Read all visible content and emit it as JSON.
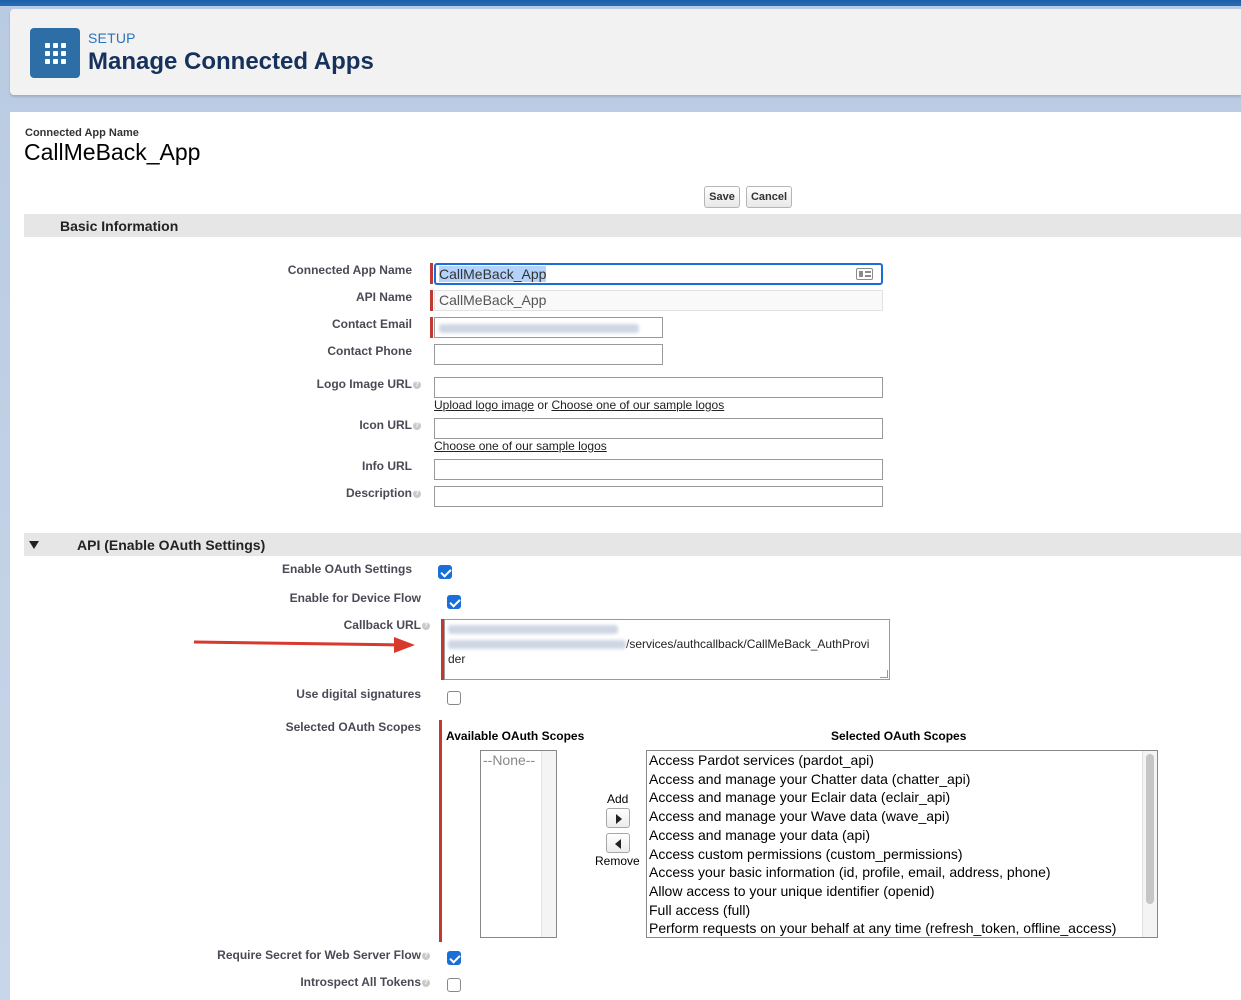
{
  "header": {
    "setup_label": "SETUP",
    "title": "Manage Connected Apps",
    "app_icon": "app-launcher-grid-icon"
  },
  "record": {
    "label": "Connected App Name",
    "name": "CallMeBack_App"
  },
  "toolbar": {
    "save_label": "Save",
    "cancel_label": "Cancel"
  },
  "basic_info": {
    "section_title": "Basic Information",
    "connected_app_name_label": "Connected App Name",
    "connected_app_name_value": "CallMeBack_App",
    "api_name_label": "API Name",
    "api_name_value": "CallMeBack_App",
    "contact_email_label": "Contact Email",
    "contact_phone_label": "Contact Phone",
    "logo_url_label": "Logo Image URL",
    "upload_logo_link": "Upload logo image",
    "or_text": "or",
    "sample_logos_link": "Choose one of our sample logos",
    "icon_url_label": "Icon URL",
    "icon_sample_logos_link": "Choose one of our sample logos",
    "info_url_label": "Info URL",
    "description_label": "Description"
  },
  "oauth": {
    "section_title": "API (Enable OAuth Settings)",
    "enable_oauth_label": "Enable OAuth Settings",
    "enable_oauth_checked": true,
    "device_flow_label": "Enable for Device Flow",
    "device_flow_checked": true,
    "callback_url_label": "Callback URL",
    "callback_url_visible_part": "/services/authcallback/CallMeBack_AuthProvi",
    "callback_url_wrap": "der",
    "digital_signatures_label": "Use digital signatures",
    "digital_signatures_checked": false,
    "selected_scopes_label": "Selected OAuth Scopes",
    "available_header": "Available OAuth Scopes",
    "selected_header": "Selected OAuth Scopes",
    "available_options": [
      "--None--"
    ],
    "add_label": "Add",
    "remove_label": "Remove",
    "selected_options": [
      "Access Pardot services (pardot_api)",
      "Access and manage your Chatter data (chatter_api)",
      "Access and manage your Eclair data (eclair_api)",
      "Access and manage your Wave data (wave_api)",
      "Access and manage your data (api)",
      "Access custom permissions (custom_permissions)",
      "Access your basic information (id, profile, email, address, phone)",
      "Allow access to your unique identifier (openid)",
      "Full access (full)",
      "Perform requests on your behalf at any time (refresh_token, offline_access)"
    ],
    "require_secret_label": "Require Secret for Web Server Flow",
    "require_secret_checked": true,
    "introspect_label": "Introspect All Tokens",
    "introspect_checked": false
  },
  "colors": {
    "accent": "#2e6ea6",
    "required": "#c23934",
    "annotation_arrow": "#d9382c",
    "checkbox": "#1a6ed8"
  }
}
